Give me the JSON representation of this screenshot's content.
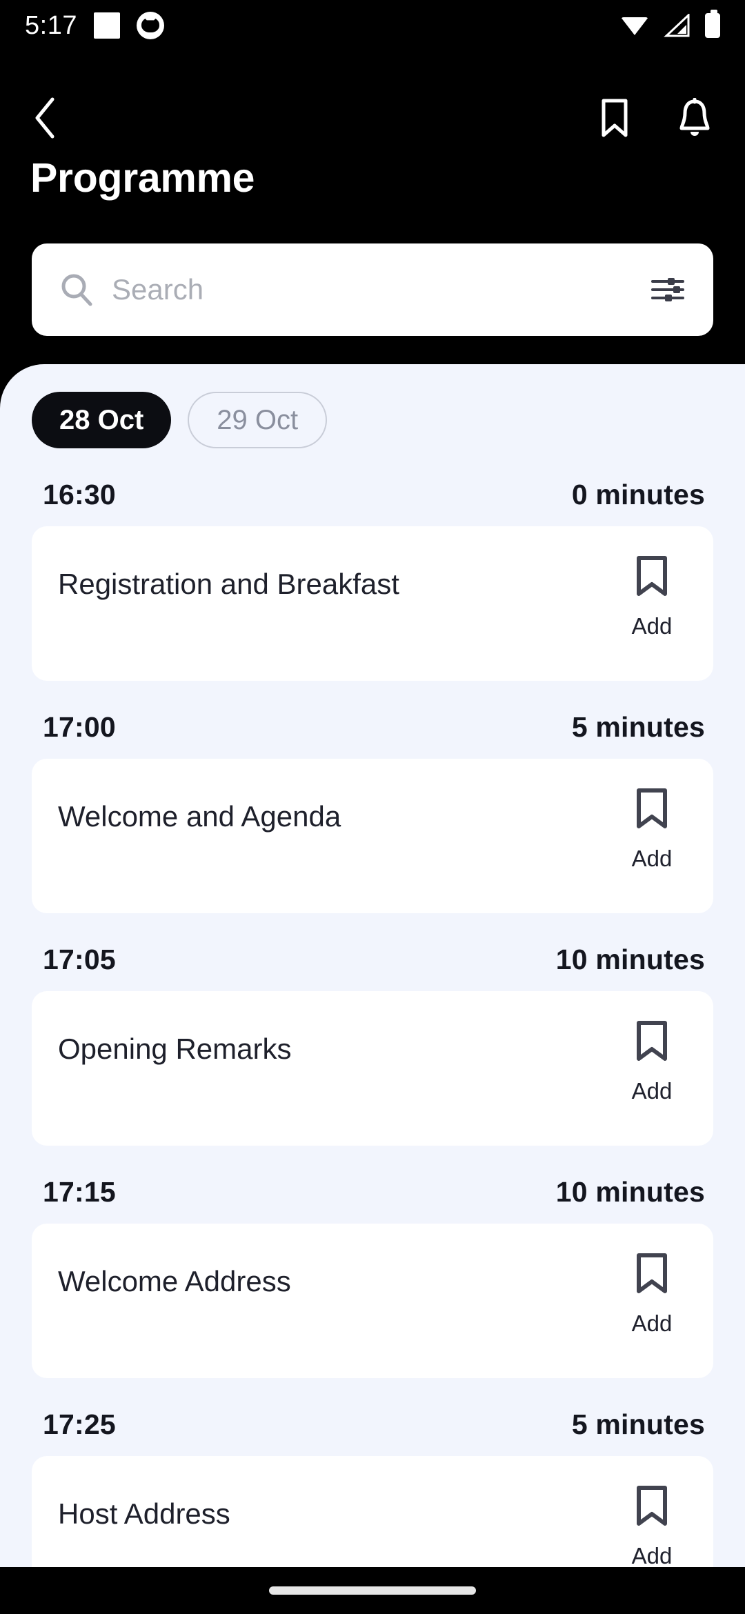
{
  "statusbar": {
    "clock": "5:17",
    "icons": [
      "notification-square-icon",
      "cat-app-icon",
      "wifi-icon",
      "cellular-signal-icon",
      "battery-icon"
    ]
  },
  "header": {
    "back_icon": "chevron-left-icon",
    "bookmark_icon": "bookmark-icon",
    "notifications_icon": "bell-icon",
    "title": "Programme"
  },
  "search": {
    "placeholder": "Search",
    "value": "",
    "search_icon": "search-icon",
    "filter_icon": "filter-sliders-icon"
  },
  "day_tabs": {
    "items": [
      {
        "label": "28 Oct",
        "active": true
      },
      {
        "label": "29 Oct",
        "active": false
      }
    ]
  },
  "schedule": {
    "sessions": [
      {
        "time": "16:30",
        "duration": "0 minutes",
        "title": "Registration and Breakfast",
        "action_label": "Add",
        "bookmark_icon": "bookmark-outline-icon"
      },
      {
        "time": "17:00",
        "duration": "5 minutes",
        "title": "Welcome and Agenda",
        "action_label": "Add",
        "bookmark_icon": "bookmark-outline-icon"
      },
      {
        "time": "17:05",
        "duration": "10 minutes",
        "title": "Opening Remarks",
        "action_label": "Add",
        "bookmark_icon": "bookmark-outline-icon"
      },
      {
        "time": "17:15",
        "duration": "10 minutes",
        "title": "Welcome Address",
        "action_label": "Add",
        "bookmark_icon": "bookmark-outline-icon"
      },
      {
        "time": "17:25",
        "duration": "5 minutes",
        "title": "Host Address",
        "action_label": "Add",
        "bookmark_icon": "bookmark-outline-icon"
      }
    ]
  },
  "bottom_nav": {
    "home_indicator": "home-indicator"
  },
  "colors": {
    "header_bg": "#000000",
    "sheet_bg": "#F2F5FD",
    "card_bg": "#FFFFFF",
    "text_primary": "#14161F",
    "icon_dark": "#41434F",
    "pill_active_bg": "#0C0D12",
    "pill_inactive_text": "#8A8F9E"
  }
}
